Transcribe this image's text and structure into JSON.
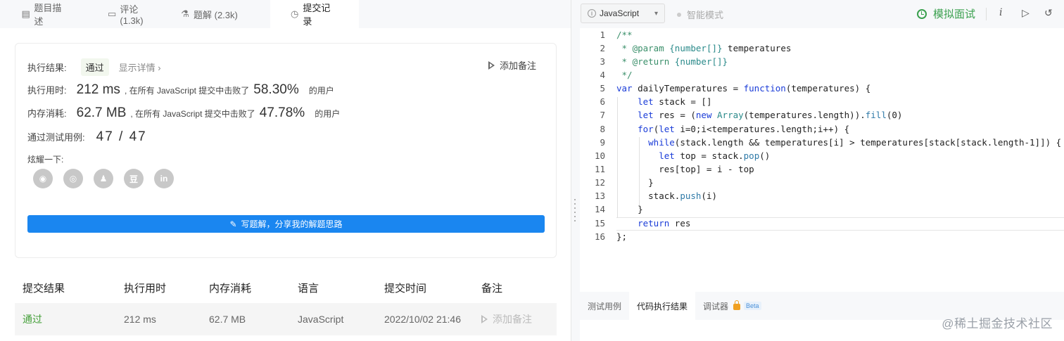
{
  "left_tabs": [
    {
      "icon": "description-icon",
      "label": "题目描述"
    },
    {
      "icon": "comment-icon",
      "label": "评论 (1.3k)"
    },
    {
      "icon": "flask-icon",
      "label": "题解 (2.3k)"
    },
    {
      "icon": "history-icon",
      "label": "提交记录"
    }
  ],
  "result": {
    "label": "执行结果:",
    "status": "通过",
    "detail": "显示详情 ›",
    "add_note": "添加备注",
    "time_label": "执行用时:",
    "time_value": "212 ms",
    "time_text": ", 在所有 JavaScript 提交中击败了",
    "time_pct": "58.30%",
    "users": "的用户",
    "mem_label": "内存消耗:",
    "mem_value": "62.7 MB",
    "mem_text": ", 在所有 JavaScript 提交中击败了",
    "mem_pct": "47.78%",
    "cases_label": "通过测试用例:",
    "cases_value": "47 / 47",
    "share_label": "炫耀一下:",
    "share_icons": [
      "wechat-icon",
      "weibo-icon",
      "qq-icon",
      "douban-icon",
      "linkedin-icon"
    ],
    "write_button": "写题解，分享我的解题思路"
  },
  "table": {
    "headers": [
      "提交结果",
      "执行用时",
      "内存消耗",
      "语言",
      "提交时间",
      "备注"
    ],
    "rows": [
      {
        "result": "通过",
        "time": "212 ms",
        "memory": "62.7 MB",
        "language": "JavaScript",
        "submitted": "2022/10/02 21:46",
        "note": "添加备注"
      }
    ]
  },
  "editor_toolbar": {
    "language": "JavaScript",
    "smart_mode": "智能模式",
    "interview": "模拟面试",
    "icons": [
      "info-icon",
      "run-icon",
      "reset-icon",
      "expand-icon"
    ]
  },
  "code": {
    "line_numbers": [
      "1",
      "2",
      "3",
      "4",
      "5",
      "6",
      "7",
      "8",
      "9",
      "10",
      "11",
      "12",
      "13",
      "14",
      "15",
      "16"
    ],
    "current_line": "15"
  },
  "bottom_tabs": [
    {
      "label": "测试用例"
    },
    {
      "label": "代码执行结果"
    },
    {
      "label": "调试器",
      "badge": "Beta"
    }
  ],
  "watermark": "@稀土掘金技术社区",
  "colors": {
    "accent": "#1a86f0",
    "success": "#3aa04e",
    "keyword": "#1a3cd8",
    "comment": "#3a8f6a"
  }
}
